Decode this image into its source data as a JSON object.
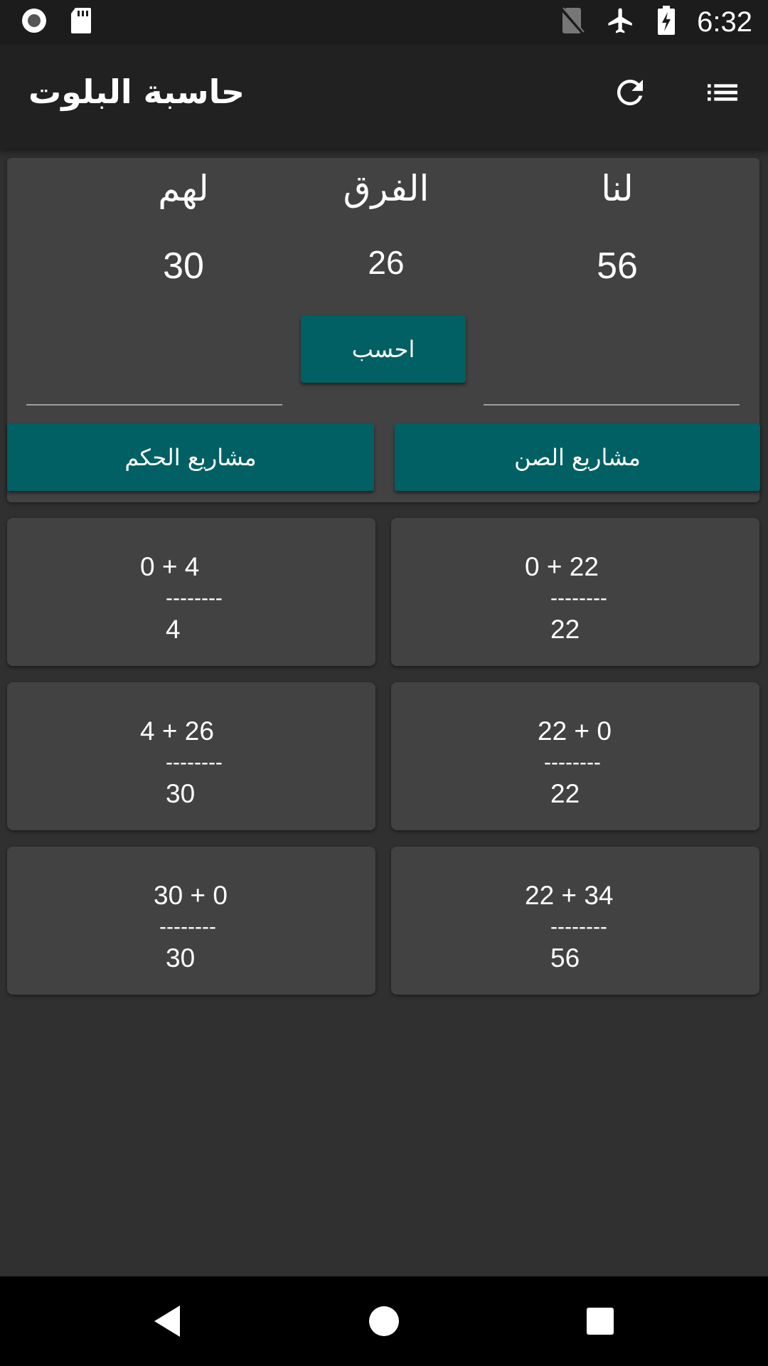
{
  "status_bar": {
    "time": "6:32",
    "icons": [
      "record-icon",
      "sd-card-icon",
      "no-sim-icon",
      "airplane-icon",
      "battery-charging-icon"
    ]
  },
  "app_bar": {
    "title": "حاسبة البلوت",
    "actions": [
      "refresh-icon",
      "list-icon"
    ]
  },
  "score": {
    "us_label": "لنا",
    "diff_label": "الفرق",
    "them_label": "لهم",
    "us_value": "56",
    "diff_value": "26",
    "them_value": "30",
    "calculate_label": "احسب",
    "us_input": "",
    "them_input": "",
    "sun_projects_label": "مشاريع الصن",
    "hokm_projects_label": "مشاريع الحكم"
  },
  "history": {
    "them": [
      {
        "expr": "0 + 4",
        "sep": "--------",
        "result": "4"
      },
      {
        "expr": "4 + 26",
        "sep": "--------",
        "result": "30"
      },
      {
        "expr": "30 + 0",
        "sep": "--------",
        "result": "30"
      }
    ],
    "us": [
      {
        "expr": "0 + 22",
        "sep": "--------",
        "result": "22"
      },
      {
        "expr": "22 + 0",
        "sep": "--------",
        "result": "22"
      },
      {
        "expr": "22 + 34",
        "sep": "--------",
        "result": "56"
      }
    ]
  },
  "colors": {
    "accent": "#006064",
    "background": "#303030",
    "card": "#424242",
    "app_bar": "#212121"
  },
  "nav": [
    "back-icon",
    "home-icon",
    "recents-icon"
  ]
}
